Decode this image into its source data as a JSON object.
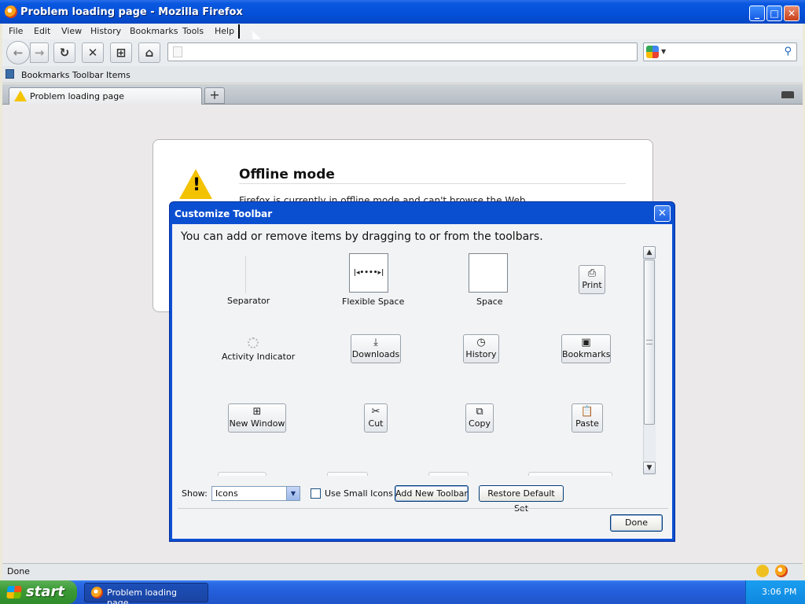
{
  "window": {
    "title": "Problem loading page - Mozilla Firefox"
  },
  "menu": [
    "File",
    "Edit",
    "View",
    "History",
    "Bookmarks",
    "Tools",
    "Help"
  ],
  "navbar": {
    "url_value": "",
    "search_value": ""
  },
  "bookmarks": {
    "label": "Bookmarks Toolbar Items"
  },
  "tabs": [
    {
      "label": "Problem loading page"
    }
  ],
  "new_tab_glyph": "+",
  "error_page": {
    "title": "Offline mode",
    "text": "Firefox is currently in offline mode and can't browse the Web."
  },
  "dialog": {
    "title": "Customize Toolbar",
    "close_glyph": "✕",
    "instructions": "You can add or remove items by dragging to or from the toolbars.",
    "items": {
      "separator": "Separator",
      "flexible_space": "Flexible Space",
      "space": "Space",
      "print": "Print",
      "activity_indicator": "Activity Indicator",
      "downloads": "Downloads",
      "history": "History",
      "bookmarks": "Bookmarks",
      "new_window": "New Window",
      "cut": "Cut",
      "copy": "Copy",
      "paste": "Paste"
    },
    "show_label": "Show:",
    "show_value": "Icons",
    "small_icons_label": "Use Small Icons",
    "small_icons_checked": false,
    "add_toolbar_label": "Add New Toolbar",
    "restore_label": "Restore Default Set",
    "done_label": "Done"
  },
  "statusbar": {
    "text": "Done"
  },
  "taskbar": {
    "start_label": "start",
    "task_label": "Problem loading page...",
    "clock": "3:06 PM"
  },
  "icons": {
    "back": "arrow-left-icon",
    "forward": "arrow-right-icon",
    "reload": "reload-icon",
    "stop": "stop-icon",
    "home": "home-icon",
    "search": "magnifier-icon",
    "warning": "warning-icon"
  }
}
